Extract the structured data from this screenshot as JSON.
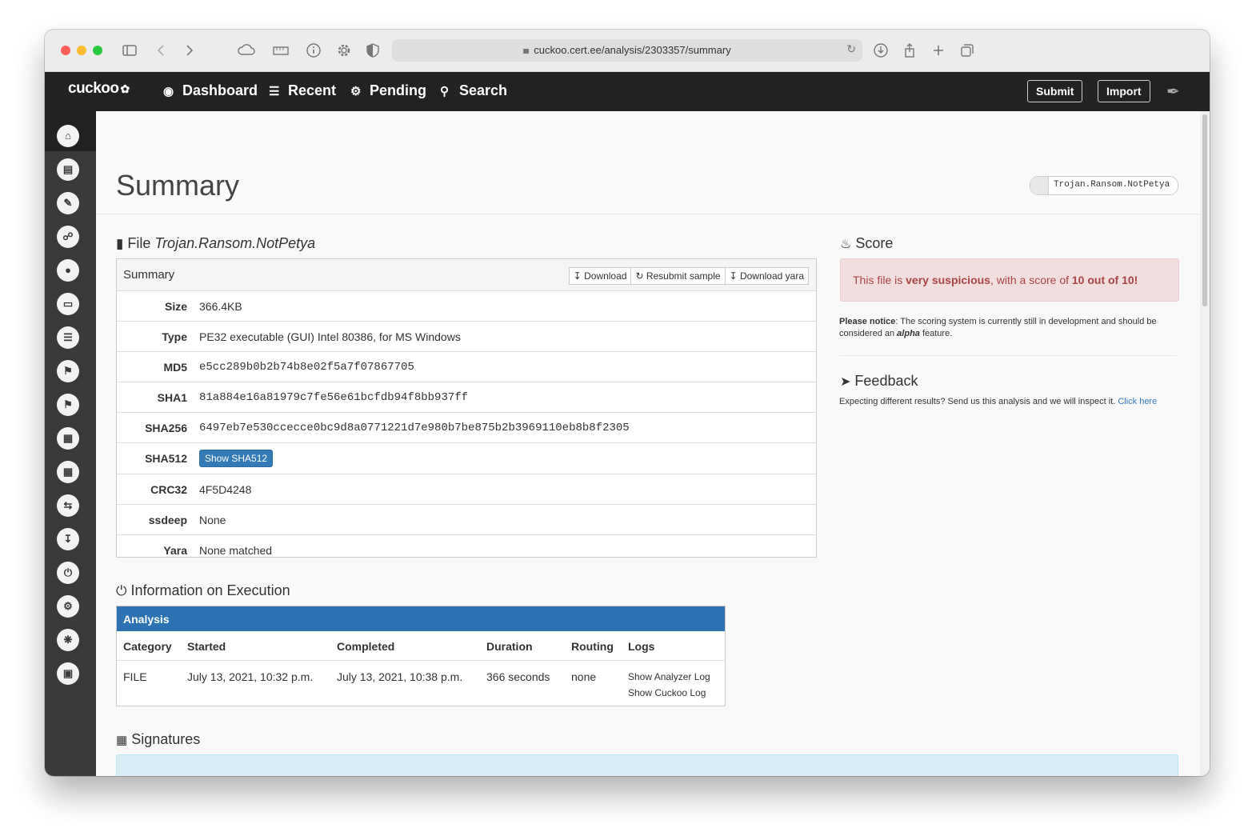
{
  "browser": {
    "url": "cuckoo.cert.ee/analysis/2303357/summary"
  },
  "navbar": {
    "brand": "cuckoo",
    "links": [
      "Dashboard",
      "Recent",
      "Pending",
      "Search"
    ],
    "submit_label": "Submit",
    "import_label": "Import"
  },
  "header": {
    "title": "Summary",
    "tag": "Trojan.Ransom.NotPetya"
  },
  "file": {
    "heading_prefix": "File",
    "heading_name": "Trojan.Ransom.NotPetya",
    "panel_title": "Summary",
    "buttons": [
      "Download",
      "Resubmit sample",
      "Download yara"
    ],
    "rows": {
      "size": {
        "label": "Size",
        "value": "366.4KB"
      },
      "type": {
        "label": "Type",
        "value": "PE32 executable (GUI) Intel 80386, for MS Windows"
      },
      "md5": {
        "label": "MD5",
        "value": "e5cc289b0b2b74b8e02f5a7f07867705"
      },
      "sha1": {
        "label": "SHA1",
        "value": "81a884e16a81979c7fe56e61bcfdb94f8bb937ff"
      },
      "sha256": {
        "label": "SHA256",
        "value": "6497eb7e530ccecce0bc9d8a0771221d7e980b7be875b2b3969110eb8b8f2305"
      },
      "sha512": {
        "label": "SHA512",
        "value": "Show SHA512"
      },
      "crc32": {
        "label": "CRC32",
        "value": "4F5D4248"
      },
      "ssdeep": {
        "label": "ssdeep",
        "value": "None"
      },
      "yara": {
        "label": "Yara",
        "value": "None matched"
      }
    }
  },
  "score": {
    "heading": "Score",
    "alert_pre": "This file is ",
    "alert_strong": "very suspicious",
    "alert_mid": ", with a score of ",
    "alert_score": "10 out of 10!",
    "notice_label": "Please notice",
    "notice_pre": ": The scoring system is currently still in development and should be considered an ",
    "notice_alpha": "alpha",
    "notice_post": " feature."
  },
  "feedback": {
    "heading": "Feedback",
    "text": "Expecting different results? Send us this analysis and we will inspect it. ",
    "link": "Click here"
  },
  "execution": {
    "heading": "Information on Execution",
    "panel_title": "Analysis",
    "columns": [
      "Category",
      "Started",
      "Completed",
      "Duration",
      "Routing",
      "Logs"
    ],
    "row": {
      "category": "FILE",
      "started": "July 13, 2021, 10:32 p.m.",
      "completed": "July 13, 2021, 10:38 p.m.",
      "duration": "366 seconds",
      "routing": "none",
      "log1": "Show Analyzer Log",
      "log2": "Show Cuckoo Log"
    }
  },
  "signatures": {
    "heading": "Signatures"
  }
}
